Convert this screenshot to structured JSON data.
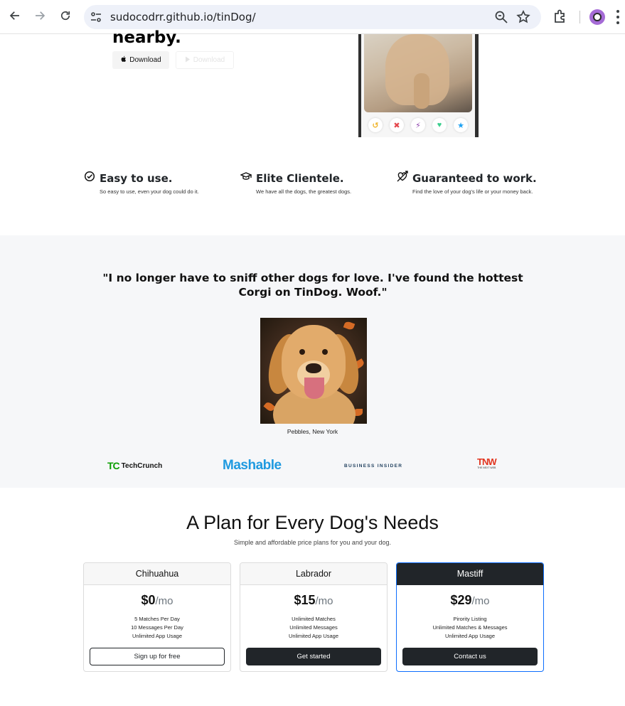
{
  "browser": {
    "url": "sudocodrr.github.io/tinDog/"
  },
  "hero": {
    "heading": "nearby.",
    "download_dark_label": "Download",
    "download_light_label": "Download"
  },
  "features": [
    {
      "title": "Easy to use.",
      "text": "So easy to use, even your dog could do it.",
      "icon": "circle-check-icon"
    },
    {
      "title": "Elite Clientele.",
      "text": "We have all the dogs, the greatest dogs.",
      "icon": "graduation-cap-icon"
    },
    {
      "title": "Guaranteed to work.",
      "text": "Find the love of your dog's life or your money back.",
      "icon": "heart-arrow-icon"
    }
  ],
  "testimonial": {
    "quote": "\"I no longer have to sniff other dogs for love. I've found the hottest Corgi on TinDog. Woof.\"",
    "caption": "Pebbles, New York"
  },
  "press": {
    "techcrunch_mark": "TC",
    "techcrunch_text": "TechCrunch",
    "mashable": "Mashable",
    "business_insider": "BUSINESS INSIDER",
    "tnw_mark": "TNW",
    "tnw_sub": "THE NEXT WEB"
  },
  "pricing": {
    "title": "A Plan for Every Dog's Needs",
    "subtitle": "Simple and affordable price plans for you and your dog.",
    "plans": [
      {
        "name": "Chihuahua",
        "price": "$0",
        "per": "/mo",
        "features": [
          "5 Matches Per Day",
          "10 Messages Per Day",
          "Unlimited App Usage"
        ],
        "button": "Sign up for free"
      },
      {
        "name": "Labrador",
        "price": "$15",
        "per": "/mo",
        "features": [
          "Unlimited Matches",
          "Unlimited Messages",
          "Unlimited App Usage"
        ],
        "button": "Get started"
      },
      {
        "name": "Mastiff",
        "price": "$29",
        "per": "/mo",
        "features": [
          "Pirority Listing",
          "Unlimited Matches & Messages",
          "Unlimited App Usage"
        ],
        "button": "Contact us"
      }
    ]
  },
  "colors": {
    "accent_blue": "#0d6efd",
    "dark": "#212529",
    "section_bg": "#f6f7f9"
  }
}
